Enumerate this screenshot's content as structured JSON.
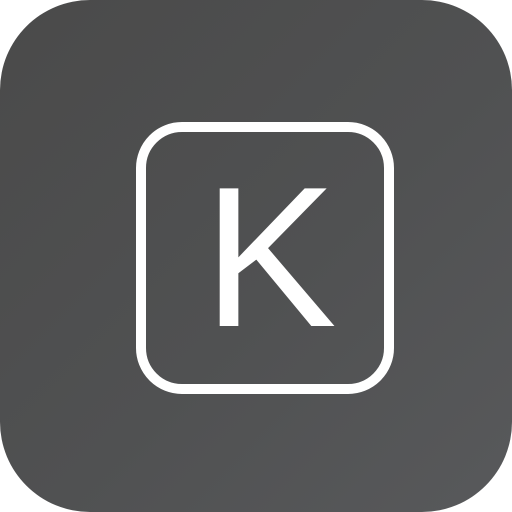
{
  "icon": {
    "letter": "K",
    "background_color": "#505152",
    "foreground_color": "#ffffff",
    "semantic": "app-icon-k-key"
  }
}
